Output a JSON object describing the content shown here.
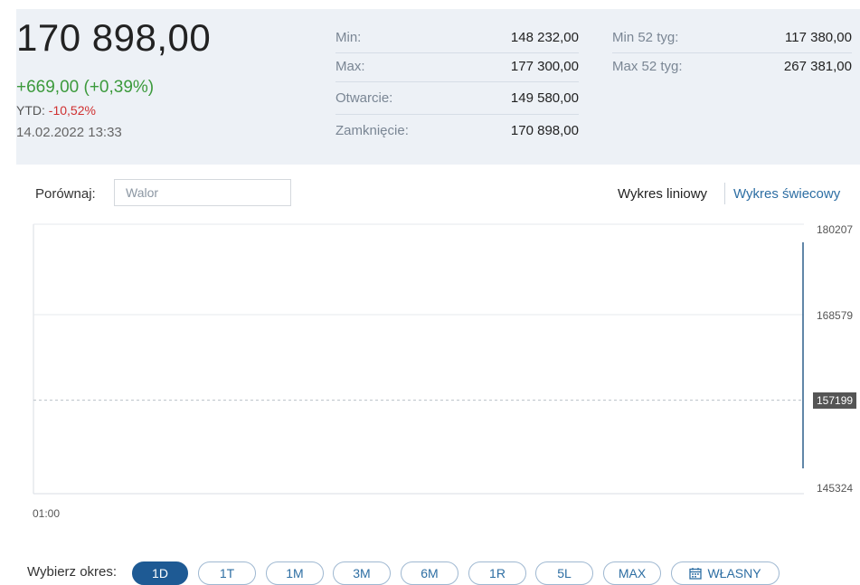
{
  "summary": {
    "price": "170 898,00",
    "change": "+669,00 (+0,39%)",
    "ytd_label": "YTD: ",
    "ytd_value": "-10,52%",
    "datetime": "14.02.2022 13:33",
    "stats": {
      "min_label": "Min:",
      "min_value": "148 232,00",
      "max_label": "Max:",
      "max_value": "177 300,00",
      "open_label": "Otwarcie:",
      "open_value": "149 580,00",
      "close_label": "Zamknięcie:",
      "close_value": "170 898,00",
      "min52_label": "Min 52 tyg:",
      "min52_value": "117 380,00",
      "max52_label": "Max 52 tyg:",
      "max52_value": "267 381,00"
    }
  },
  "compare": {
    "label": "Porównaj:",
    "placeholder": "Walor"
  },
  "chart_toggle": {
    "line": "Wykres liniowy",
    "candle": "Wykres świecowy"
  },
  "chart": {
    "y_ticks": [
      "180207",
      "168579",
      "145324"
    ],
    "current_badge": "157199",
    "x_tick": "01:00"
  },
  "chart_data": {
    "type": "line",
    "x": [
      "13:33"
    ],
    "series": [
      {
        "values": [
          157199
        ]
      }
    ],
    "ylim": [
      145324,
      180207
    ],
    "y_ticks": [
      180207,
      168579,
      145324
    ],
    "current_value": 157199,
    "x_ticks": [
      "01:00"
    ],
    "grid": true
  },
  "period": {
    "label": "Wybierz okres:",
    "options": [
      "1D",
      "1T",
      "1M",
      "3M",
      "6M",
      "1R",
      "5L",
      "MAX"
    ],
    "custom": "WŁASNY",
    "active": "1D"
  },
  "colors": {
    "accent": "#1e5a94",
    "positive": "#3c9a3c",
    "negative": "#d03030",
    "panel_bg": "#edf1f6"
  },
  "icons": {
    "custom_period": "calendar-icon"
  }
}
